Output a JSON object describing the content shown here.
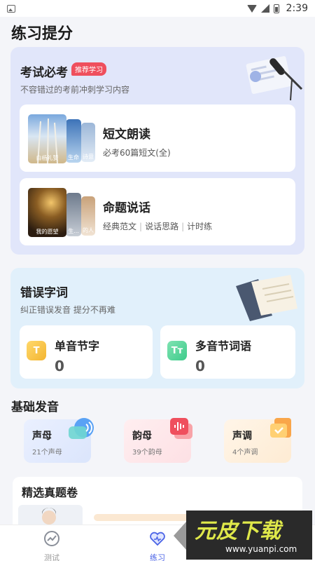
{
  "status_bar": {
    "time": "2:39"
  },
  "page": {
    "title": "练习提分"
  },
  "exam_section": {
    "title": "考试必考",
    "badge": "推荐学习",
    "subtitle": "不容错过的考前冲刺学习内容",
    "items": [
      {
        "title": "短文朗读",
        "subtitle": "必考60篇短文(全)",
        "thumb_labels": [
          "白杨礼赞",
          "生命",
          "诗意"
        ]
      },
      {
        "title": "命题说话",
        "tags": [
          "经典范文",
          "说话思路",
          "计时练"
        ],
        "thumb_labels": [
          "我的愿望",
          "生...",
          "的人"
        ]
      }
    ]
  },
  "mistake_section": {
    "title": "错误字词",
    "subtitle": "纠正错误发音 提分不再难",
    "cards": [
      {
        "label": "单音节字",
        "count": "0",
        "icon_text": "T",
        "icon": "single-syllable-icon"
      },
      {
        "label": "多音节词语",
        "count": "0",
        "icon_text": "Tт",
        "icon": "multi-syllable-icon"
      }
    ]
  },
  "basics_section": {
    "title": "基础发音",
    "cards": [
      {
        "title": "声母",
        "subtitle": "21个声母",
        "icon": "speech-bubble-icon"
      },
      {
        "title": "韵母",
        "subtitle": "39个韵母",
        "icon": "waveform-icon"
      },
      {
        "title": "声调",
        "subtitle": "4个声调",
        "icon": "document-check-icon"
      }
    ]
  },
  "papers_section": {
    "title": "精选真题卷"
  },
  "bottom_nav": {
    "items": [
      {
        "label": "测试",
        "icon": "test-gauge-icon",
        "active": false
      },
      {
        "label": "练习",
        "icon": "practice-heart-icon",
        "active": true
      }
    ]
  },
  "watermark": {
    "main": "元皮下载",
    "url": "www.yuanpi.com"
  },
  "colors": {
    "accent": "#4a63e6",
    "badge_red": "#ef4f5d",
    "exam_bg": "#e1e6fa",
    "mistake_bg": "#e1f0fb"
  }
}
